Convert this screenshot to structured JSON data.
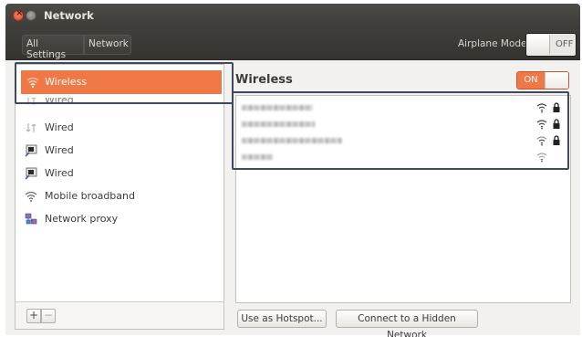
{
  "window": {
    "title": "Network"
  },
  "toolbar": {
    "breadcrumbs": [
      "All Settings",
      "Network"
    ],
    "airplane_mode_label": "Airplane Mode",
    "airplane_mode_state": "OFF"
  },
  "sidebar": {
    "items": [
      {
        "label": "Wireless",
        "icon": "wifi-icon",
        "selected": true
      },
      {
        "label": "Wired",
        "icon": "wired-icon"
      },
      {
        "label": "Wired",
        "icon": "wired-icon"
      },
      {
        "label": "Wired",
        "icon": "network-card-icon"
      },
      {
        "label": "Wired",
        "icon": "network-card-icon"
      },
      {
        "label": "Mobile broadband",
        "icon": "mobile-broadband-icon"
      },
      {
        "label": "Network proxy",
        "icon": "network-proxy-icon"
      }
    ],
    "add_label": "+",
    "remove_label": "−"
  },
  "main": {
    "title": "Wireless",
    "toggle_state": "ON",
    "networks": [
      {
        "name_obscured": true,
        "secured": true
      },
      {
        "name_obscured": true,
        "secured": true
      },
      {
        "name_obscured": true,
        "secured": true
      },
      {
        "name_obscured": true,
        "secured": false
      }
    ],
    "hotspot_button": "Use as Hotspot...",
    "hidden_network_button": "Connect to a Hidden Network"
  },
  "colors": {
    "accent": "#f07746",
    "titlebar": "#3d3c38",
    "highlight_box": "#3d4b5c"
  }
}
